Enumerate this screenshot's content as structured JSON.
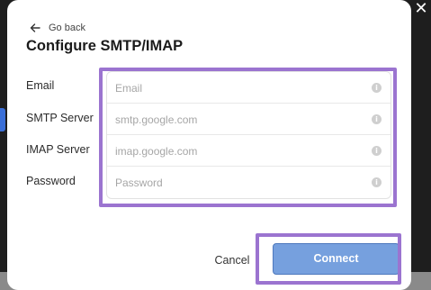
{
  "modal": {
    "back_label": "Go back",
    "title": "Configure SMTP/IMAP",
    "close_icon": "close-icon",
    "fields": [
      {
        "label": "Email",
        "placeholder": "Email",
        "value": ""
      },
      {
        "label": "SMTP Server",
        "placeholder": "smtp.google.com",
        "value": ""
      },
      {
        "label": "IMAP Server",
        "placeholder": "imap.google.com",
        "value": ""
      },
      {
        "label": "Password",
        "placeholder": "Password",
        "value": ""
      }
    ],
    "info_icon": "info-icon",
    "cancel_label": "Cancel",
    "connect_label": "Connect"
  },
  "colors": {
    "accent": "#76a0de",
    "highlight": "#9b74d0",
    "backdrop": "#1e1e1e"
  }
}
